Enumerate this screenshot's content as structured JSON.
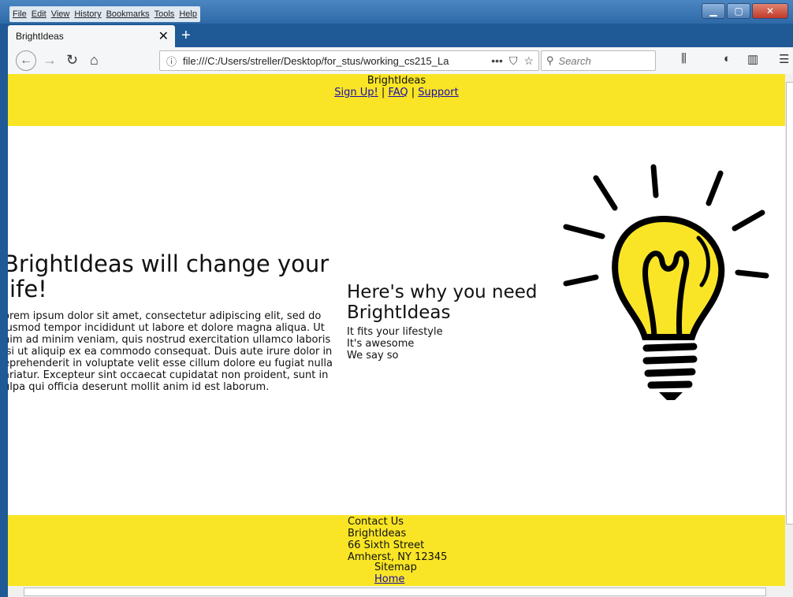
{
  "menu": [
    "File",
    "Edit",
    "View",
    "History",
    "Bookmarks",
    "Tools",
    "Help"
  ],
  "tab": {
    "title": "BrightIdeas",
    "close": "✕"
  },
  "newtab": "+",
  "url": "file:///C:/Users/streller/Desktop/for_stus/working_cs215_La",
  "search_placeholder": "Search",
  "header": {
    "brand": "BrightIdeas",
    "signup": "Sign Up!",
    "faq": "FAQ",
    "support": "Support",
    "sep": "|"
  },
  "hero": {
    "title": "BrightIdeas will change your life!",
    "body": "orem ipsum dolor sit amet, consectetur adipiscing elit, sed do iusmod tempor incididunt ut labore et dolore magna aliqua. Ut nim ad minim veniam, quis nostrud exercitation ullamco laboris isi ut aliquip ex ea commodo consequat. Duis aute irure dolor in eprehenderit in voluptate velit esse cillum dolore eu fugiat nulla ariatur. Excepteur sint occaecat cupidatat non proident, sunt in ulpa qui officia deserunt mollit anim id est laborum."
  },
  "why": {
    "title": "Here's why you need BrightIdeas",
    "items": [
      "It fits your lifestyle",
      "It's awesome",
      "We say so"
    ]
  },
  "footer": {
    "contact": "Contact Us",
    "name": "BrightIdeas",
    "street": "66 Sixth Street",
    "city": "Amherst, NY 12345",
    "sitemap": "Sitemap",
    "home": "Home"
  },
  "colors": {
    "banner": "#f9e526",
    "link": "#1a0dab"
  }
}
